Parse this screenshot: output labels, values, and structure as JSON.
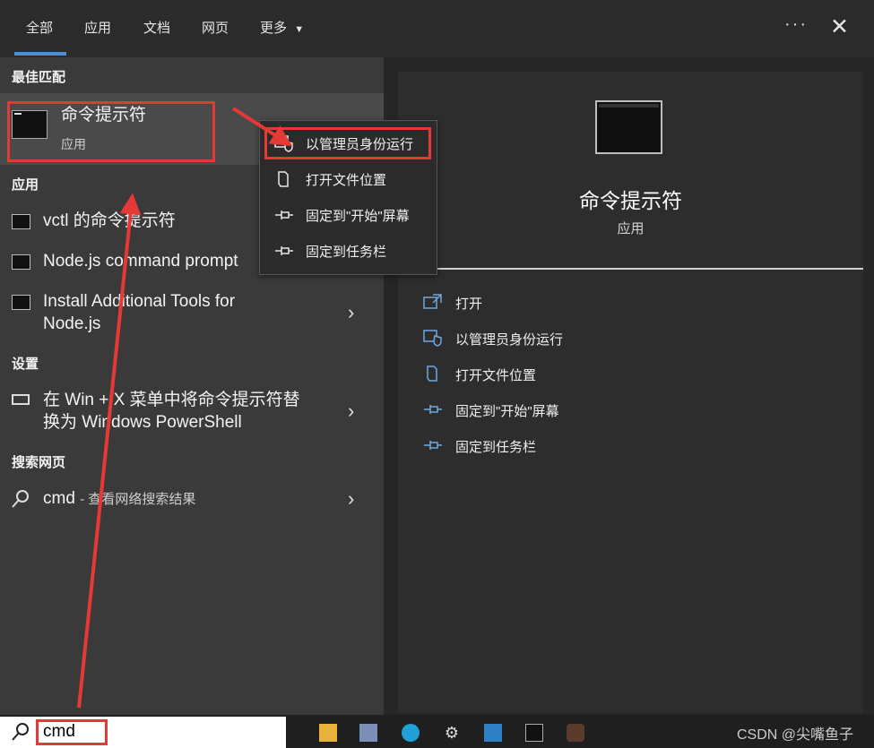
{
  "tabs": [
    {
      "label": "全部"
    },
    {
      "label": "应用"
    },
    {
      "label": "文档"
    },
    {
      "label": "网页"
    },
    {
      "label": "更多"
    }
  ],
  "sections": {
    "best_match": "最佳匹配",
    "apps": "应用",
    "settings": "设置",
    "web": "搜索网页"
  },
  "best_match": {
    "title": "命令提示符",
    "subtitle": "应用"
  },
  "app_results": [
    {
      "label": "vctl 的命令提示符"
    },
    {
      "label": "Node.js command prompt"
    },
    {
      "label_line1": "Install Additional Tools for",
      "label_line2": "Node.js"
    }
  ],
  "setting_result": {
    "line1": "在 Win + X 菜单中将命令提示符替",
    "line2": "换为 Windows PowerShell"
  },
  "web_result": {
    "query": "cmd",
    "hint": "- 查看网络搜索结果"
  },
  "context_menu": [
    {
      "label": "以管理员身份运行",
      "icon": "shield-icon"
    },
    {
      "label": "打开文件位置",
      "icon": "folder-icon"
    },
    {
      "label": "固定到\"开始\"屏幕",
      "icon": "pin-icon"
    },
    {
      "label": "固定到任务栏",
      "icon": "pin-icon"
    }
  ],
  "preview": {
    "title": "命令提示符",
    "subtitle": "应用"
  },
  "actions": [
    {
      "label": "打开",
      "icon": "open-icon"
    },
    {
      "label": "以管理员身份运行",
      "icon": "shield-icon"
    },
    {
      "label": "打开文件位置",
      "icon": "folder-icon"
    },
    {
      "label": "固定到\"开始\"屏幕",
      "icon": "pin-icon"
    },
    {
      "label": "固定到任务栏",
      "icon": "pin-icon"
    }
  ],
  "search": {
    "value": "cmd"
  },
  "watermark": "CSDN @尖嘴鱼子",
  "colors": {
    "annotation": "#e53935",
    "accent": "#4f8fd8"
  }
}
